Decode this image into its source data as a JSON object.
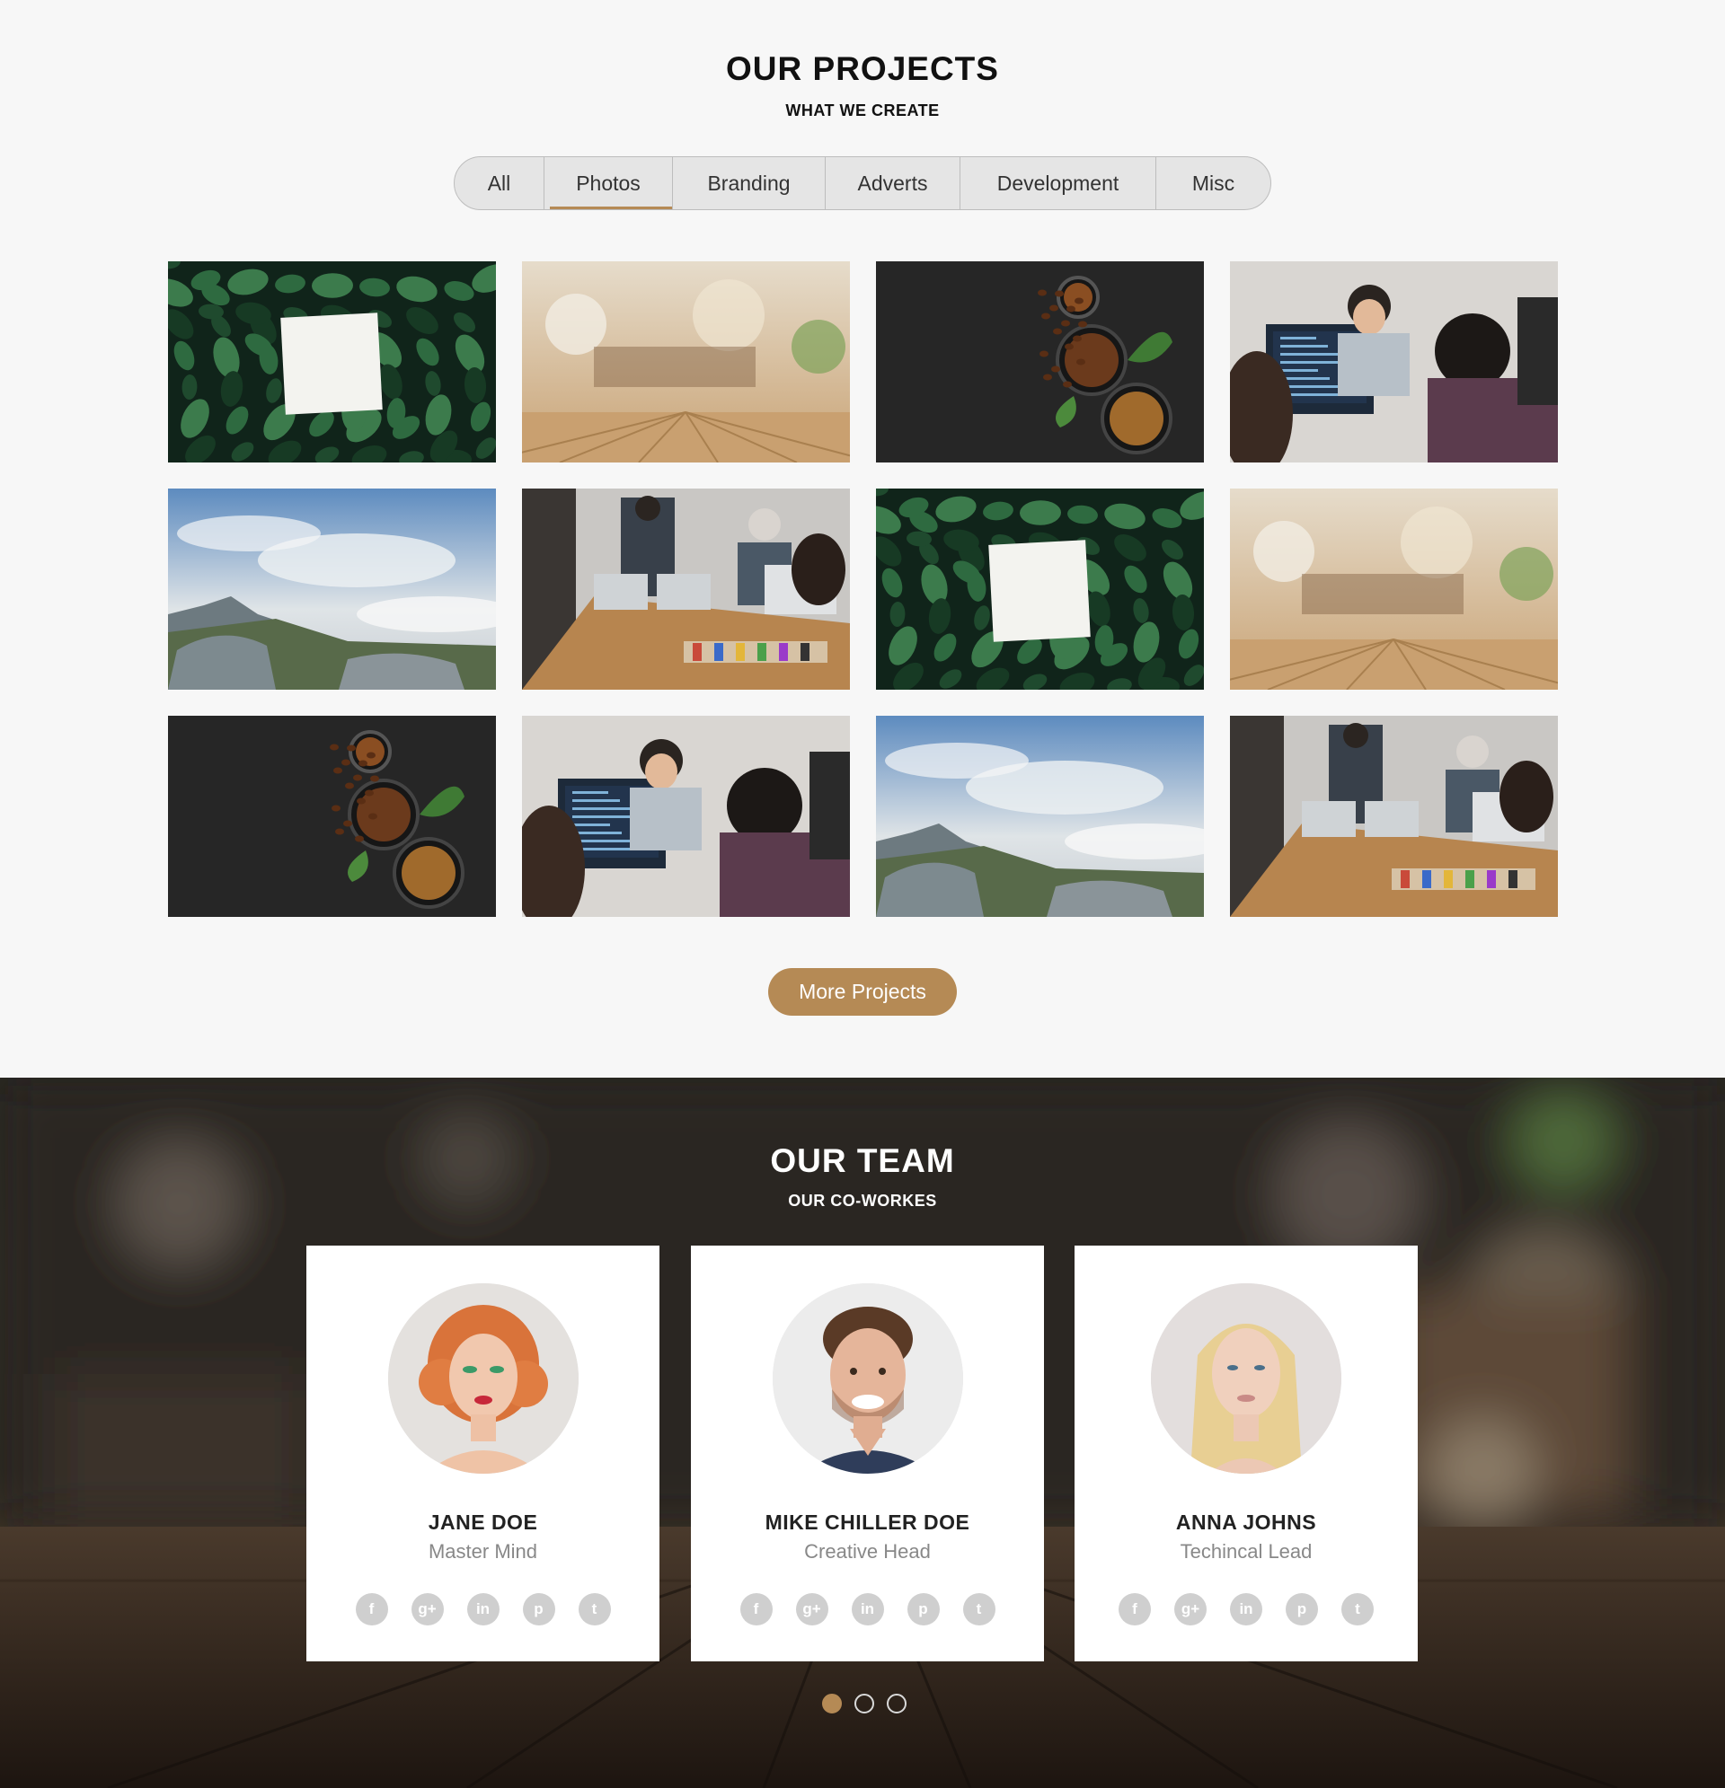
{
  "projects": {
    "title": "OUR PROJECTS",
    "subtitle": "WHAT WE CREATE",
    "filters": [
      "All",
      "Photos",
      "Branding",
      "Adverts",
      "Development",
      "Misc"
    ],
    "active_filter": "Photos",
    "gallery": [
      "leaves-card-photo",
      "cafe-bokeh-photo",
      "coffee-beans-photo",
      "office-workers-photo",
      "mountain-sky-photo",
      "meeting-room-photo",
      "leaves-card-photo",
      "cafe-bokeh-photo",
      "coffee-beans-photo",
      "office-workers-photo",
      "mountain-sky-photo",
      "meeting-room-photo"
    ],
    "more_button": "More Projects"
  },
  "team": {
    "title": "OUR TEAM",
    "subtitle": "OUR CO-WORKES",
    "members": [
      {
        "name": "JANE DOE",
        "role": "Master Mind"
      },
      {
        "name": "MIKE CHILLER DOE",
        "role": "Creative Head"
      },
      {
        "name": "ANNA JOHNS",
        "role": "Techincal Lead"
      }
    ],
    "social_icons": [
      "facebook-icon",
      "google-plus-icon",
      "linkedin-icon",
      "pinterest-icon",
      "twitter-icon"
    ],
    "social_glyphs": [
      "f",
      "g+",
      "in",
      "p",
      "t"
    ],
    "slider_dots": 3,
    "active_dot": 0
  },
  "colors": {
    "accent": "#b58a55",
    "background": "#f7f7f7",
    "social_icon": "#cfcfcf"
  }
}
